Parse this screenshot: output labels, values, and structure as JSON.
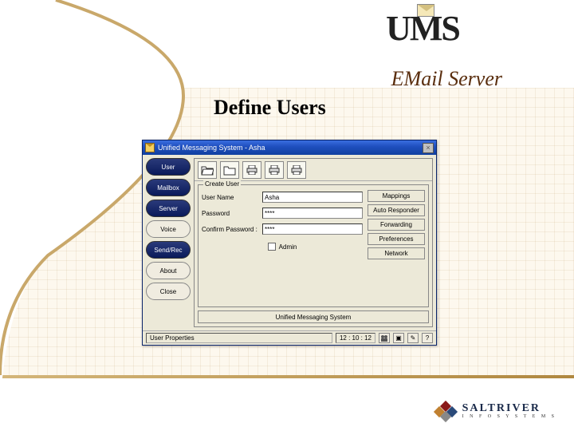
{
  "header": {
    "logo_text": "UMS",
    "product_subtitle": "EMail Server"
  },
  "page_title": "Define Users",
  "window": {
    "title": "Unified Messaging System - Asha",
    "sidebar": [
      {
        "label": "User",
        "style": "dark"
      },
      {
        "label": "Mailbox",
        "style": "dark"
      },
      {
        "label": "Server",
        "style": "dark"
      },
      {
        "label": "Voice",
        "style": "light"
      },
      {
        "label": "Send/Rec",
        "style": "dark"
      },
      {
        "label": "About",
        "style": "light"
      },
      {
        "label": "Close",
        "style": "light"
      }
    ],
    "groupbox_legend": "Create User",
    "form": {
      "username_label": "User Name",
      "username_value": "Asha",
      "password_label": "Password",
      "password_value": "****",
      "confirm_label": "Confirm Password :",
      "confirm_value": "****",
      "admin_label": "Admin"
    },
    "right_buttons": [
      "Mappings",
      "Auto Responder",
      "Forwarding",
      "Preferences",
      "Network"
    ],
    "message_bar": "Unified Messaging System",
    "status": {
      "left_label": "User Properties",
      "time": "12 : 10 : 12"
    }
  },
  "footer": {
    "company": "SALTRIVER",
    "tagline": "I N F O S Y S T E M S"
  }
}
